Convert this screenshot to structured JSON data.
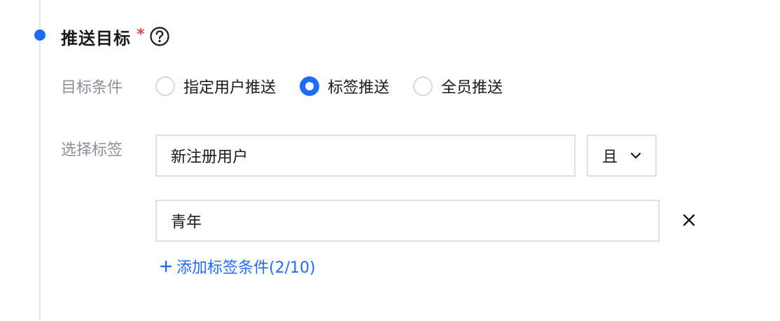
{
  "section": {
    "title": "推送目标",
    "required_mark": "*"
  },
  "target_condition": {
    "label": "目标条件",
    "options": [
      {
        "label": "指定用户推送",
        "checked": false
      },
      {
        "label": "标签推送",
        "checked": true
      },
      {
        "label": "全员推送",
        "checked": false
      }
    ]
  },
  "tag_select": {
    "label": "选择标签",
    "tags": [
      {
        "value": "新注册用户"
      },
      {
        "value": "青年"
      }
    ],
    "logic_operator": "且",
    "add_condition_label": "添加标签条件(2/10)"
  },
  "icons": {
    "help": "question-circle-icon",
    "chevron": "chevron-down-icon",
    "remove": "close-icon",
    "add": "plus-icon"
  },
  "colors": {
    "accent": "#1e6cff",
    "required": "#e54545",
    "label": "#8a8f99",
    "border": "#dcdfe6"
  }
}
